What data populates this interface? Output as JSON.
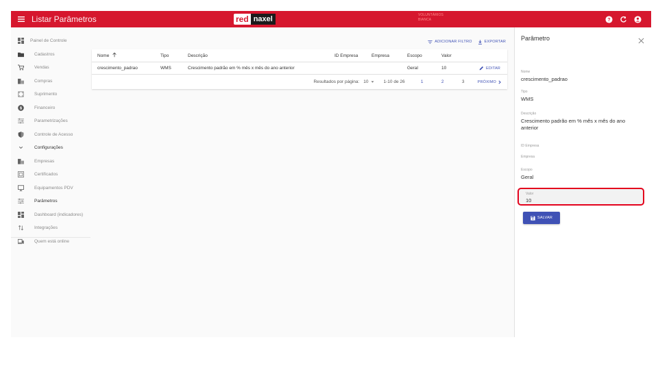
{
  "colors": {
    "topbar": "#d6172e",
    "accent": "#3f51b5",
    "highlight": "#e3001b"
  },
  "topbar": {
    "title": "Listar Parâmetros",
    "logo_part1": "red",
    "logo_part2": "naxel",
    "user_line1": "VOLUNTÁRIOS",
    "user_line2": "BIANCA",
    "icons": [
      "help-icon",
      "refresh-icon",
      "account-icon"
    ]
  },
  "sidebar": {
    "items": [
      {
        "label": "Painel de Controle",
        "icon": "dashboard-icon"
      },
      {
        "label": "Cadastros",
        "icon": "folder-icon"
      },
      {
        "label": "Vendas",
        "icon": "cart-icon"
      },
      {
        "label": "Compras",
        "icon": "building-icon"
      },
      {
        "label": "Suprimento",
        "icon": "box-icon"
      },
      {
        "label": "Financeiro",
        "icon": "dollar-icon"
      },
      {
        "label": "Parametrizações",
        "icon": "tune-icon"
      },
      {
        "label": "Controle de Acesso",
        "icon": "shield-icon"
      },
      {
        "label": "Configurações",
        "icon": "chevron-down-icon"
      },
      {
        "label": "Empresas",
        "icon": "building-icon"
      },
      {
        "label": "Certificados",
        "icon": "certificate-icon"
      },
      {
        "label": "Equipamentos PDV",
        "icon": "monitor-icon"
      },
      {
        "label": "Parâmetros",
        "icon": "tune-icon"
      },
      {
        "label": "Dashboard (indicadores)",
        "icon": "dashboard-icon"
      },
      {
        "label": "Integrações",
        "icon": "swap-icon"
      },
      {
        "label": "Quem está online",
        "icon": "devices-icon"
      }
    ]
  },
  "toolbar": {
    "filter_label": "ADICIONAR FILTRO",
    "export_label": "EXPORTAR"
  },
  "table": {
    "headers": {
      "nome": "Nome",
      "tipo": "Tipo",
      "descricao": "Descrição",
      "id_empresa": "ID Empresa",
      "empresa": "Empresa",
      "escopo": "Escopo",
      "valor": "Valor"
    },
    "rows": [
      {
        "nome": "crescimento_padrao",
        "tipo": "WMS",
        "descricao": "Crescimento padrão em % mês x mês do ano anterior",
        "id_empresa": "",
        "empresa": "",
        "escopo": "Geral",
        "valor": "10",
        "action": "EDITAR"
      }
    ]
  },
  "pagination": {
    "per_page_label": "Resultados por página:",
    "per_page": "10",
    "range": "1-10 de 26",
    "pages": [
      "1",
      "2",
      "3"
    ],
    "next_label": "PRÓXIMO"
  },
  "panel": {
    "title": "Parâmetro",
    "fields": {
      "nome": {
        "label": "Nome",
        "value": "crescimento_padrao"
      },
      "tipo": {
        "label": "Tipo",
        "value": "WMS"
      },
      "descricao": {
        "label": "Descrição",
        "value": "Crescimento padrão em % mês x mês do ano anterior"
      },
      "id_empresa": {
        "label": "ID Empresa",
        "value": ""
      },
      "empresa": {
        "label": "Empresa",
        "value": ""
      },
      "escopo": {
        "label": "Escopo",
        "value": "Geral"
      }
    },
    "valor": {
      "label": "Valor",
      "value": "10"
    },
    "save_label": "SALVAR"
  }
}
